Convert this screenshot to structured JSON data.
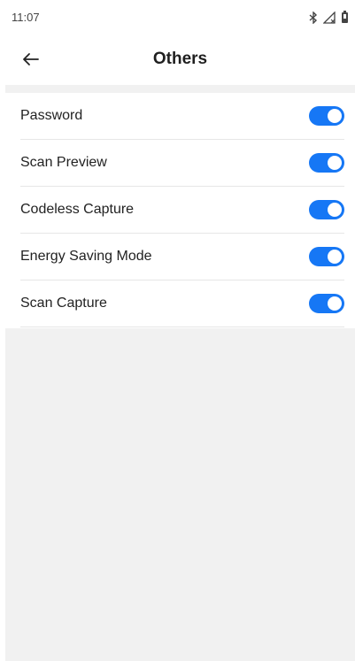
{
  "status_bar": {
    "time": "11:07",
    "icons": [
      "bluetooth-icon",
      "signal-icon",
      "battery-icon"
    ]
  },
  "app_bar": {
    "title": "Others",
    "back_icon": "arrow-left-icon"
  },
  "settings": [
    {
      "label": "Password",
      "enabled": true
    },
    {
      "label": "Scan Preview",
      "enabled": true
    },
    {
      "label": "Codeless Capture",
      "enabled": true
    },
    {
      "label": "Energy Saving Mode",
      "enabled": true
    },
    {
      "label": "Scan Capture",
      "enabled": true
    }
  ],
  "colors": {
    "accent": "#1677f5",
    "background": "#ffffff",
    "panel": "#f1f1f1",
    "divider": "#e6e6e6",
    "text": "#222222"
  }
}
